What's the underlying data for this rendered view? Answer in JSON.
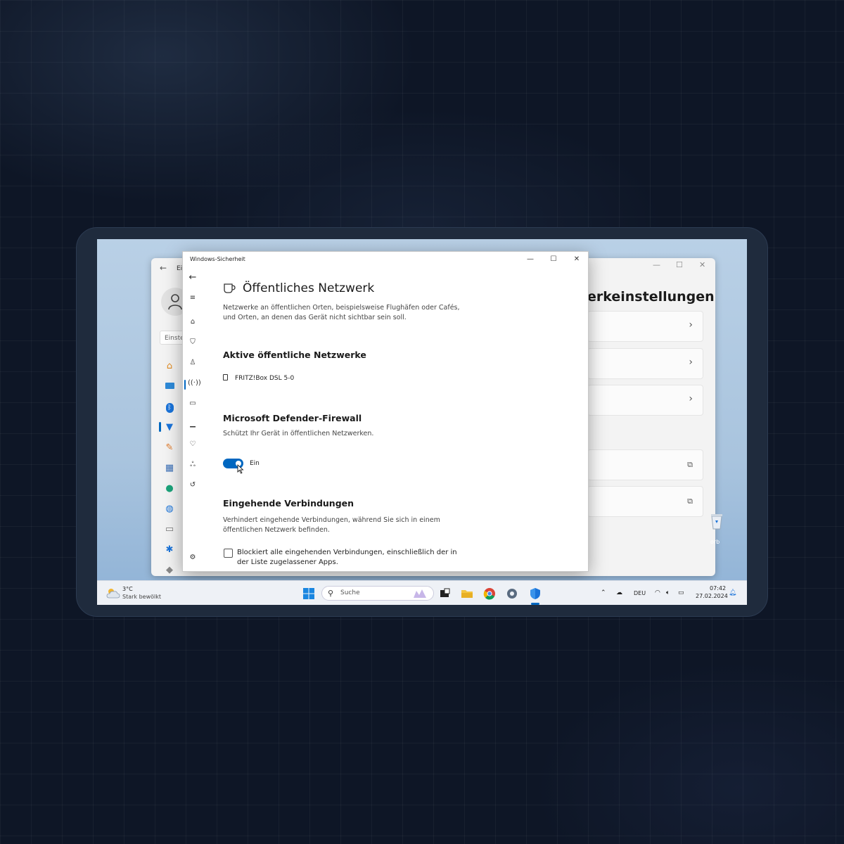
{
  "dialog": {
    "window_title": "Windows-Sicherheit",
    "page_title": "Öffentliches Netzwerk",
    "description": "Netzwerke an öffentlichen Orten, beispielsweise Flughäfen oder Cafés, und Orten, an denen das Gerät nicht sichtbar sein soll.",
    "active_networks": {
      "heading": "Aktive öffentliche Netzwerke",
      "items": [
        "FRITZ!Box DSL 5-0"
      ]
    },
    "firewall": {
      "heading": "Microsoft Defender-Firewall",
      "description": "Schützt Ihr Gerät in öffentlichen Netzwerken.",
      "toggle_on": true,
      "toggle_label": "Ein"
    },
    "incoming": {
      "heading": "Eingehende Verbindungen",
      "description": "Verhindert eingehende Verbindungen, während Sie sich in einem öffentlichen Netzwerk befinden.",
      "checkbox_checked": false,
      "checkbox_label": "Blockiert alle eingehenden Verbindungen, einschließlich der in der Liste zugelassener Apps."
    },
    "nav_icons": [
      "back-arrow-icon",
      "hamburger-menu-icon",
      "home-icon",
      "shield-icon",
      "account-icon",
      "network-icon",
      "app-browser-icon",
      "device-security-icon",
      "health-icon",
      "family-icon",
      "history-icon",
      "settings-icon"
    ]
  },
  "settings_window": {
    "title_fragment": "Ei",
    "heading_fragment": "erkeinstellungen",
    "search_placeholder": "Einste"
  },
  "desktop": {
    "icon_label_fragment": "orb"
  },
  "taskbar": {
    "weather_temp": "3°C",
    "weather_desc": "Stark bewölkt",
    "search_placeholder": "Suche",
    "language": "DEU",
    "time": "07:42",
    "date": "27.02.2024",
    "accent": "#0067c0"
  }
}
